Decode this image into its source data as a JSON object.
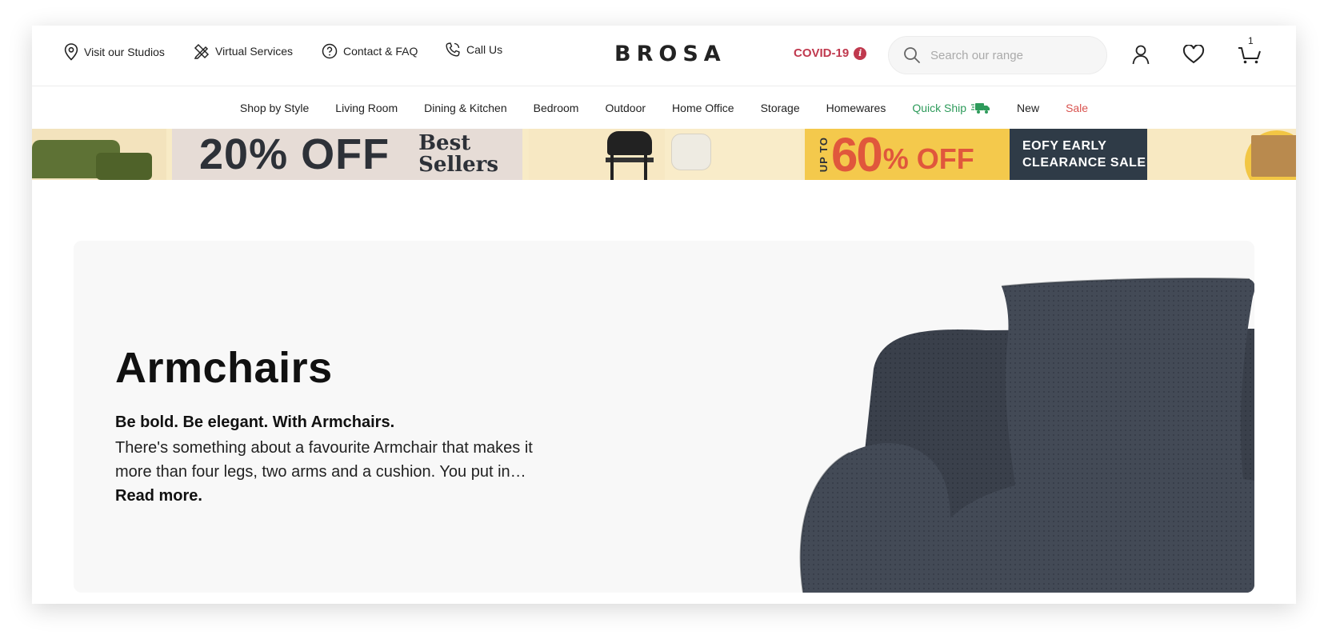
{
  "header": {
    "utility_links": [
      {
        "label": "Visit our Studios",
        "icon": "map-pin-icon"
      },
      {
        "label": "Virtual Services",
        "icon": "pencil-ruler-icon"
      },
      {
        "label": "Contact & FAQ",
        "icon": "question-circle-icon"
      },
      {
        "label": "Call Us",
        "icon": "phone-icon"
      }
    ],
    "logo": "BROSA",
    "covid_label": "COVID-19",
    "covid_info_glyph": "i",
    "search_placeholder": "Search our range",
    "account_icon": "user-icon",
    "wishlist_icon": "heart-icon",
    "cart_icon": "cart-icon",
    "cart_count": "1"
  },
  "nav": {
    "items": [
      "Shop by Style",
      "Living Room",
      "Dining & Kitchen",
      "Bedroom",
      "Outdoor",
      "Home Office",
      "Storage",
      "Homewares",
      "Quick Ship",
      "New",
      "Sale"
    ],
    "quick_ship_icon": "truck-icon",
    "quick_ship_color": "#2e9b5b",
    "sale_color": "#d9534f"
  },
  "promo": {
    "offer1_big": "20% OFF",
    "offer1_side_line1": "Best",
    "offer1_side_line2": "Sellers",
    "offer2_upto": "UP TO",
    "offer2_big": "60",
    "offer2_suffix": "% OFF",
    "offer2_side_line1": "EOFY EARLY",
    "offer2_side_line2": "CLEARANCE SALE"
  },
  "hero": {
    "title": "Armchairs",
    "subtitle": "Be bold. Be elegant. With Armchairs.",
    "body": "There's something about a favourite Armchair that makes it more than four legs, two arms and a cushion. You put in…",
    "read_more": "Read more."
  },
  "colors": {
    "accent_covid": "#c0394e",
    "promo_dark": "#2f3b47",
    "promo_yellow": "#f4c94c",
    "promo_orange": "#e0573c"
  }
}
